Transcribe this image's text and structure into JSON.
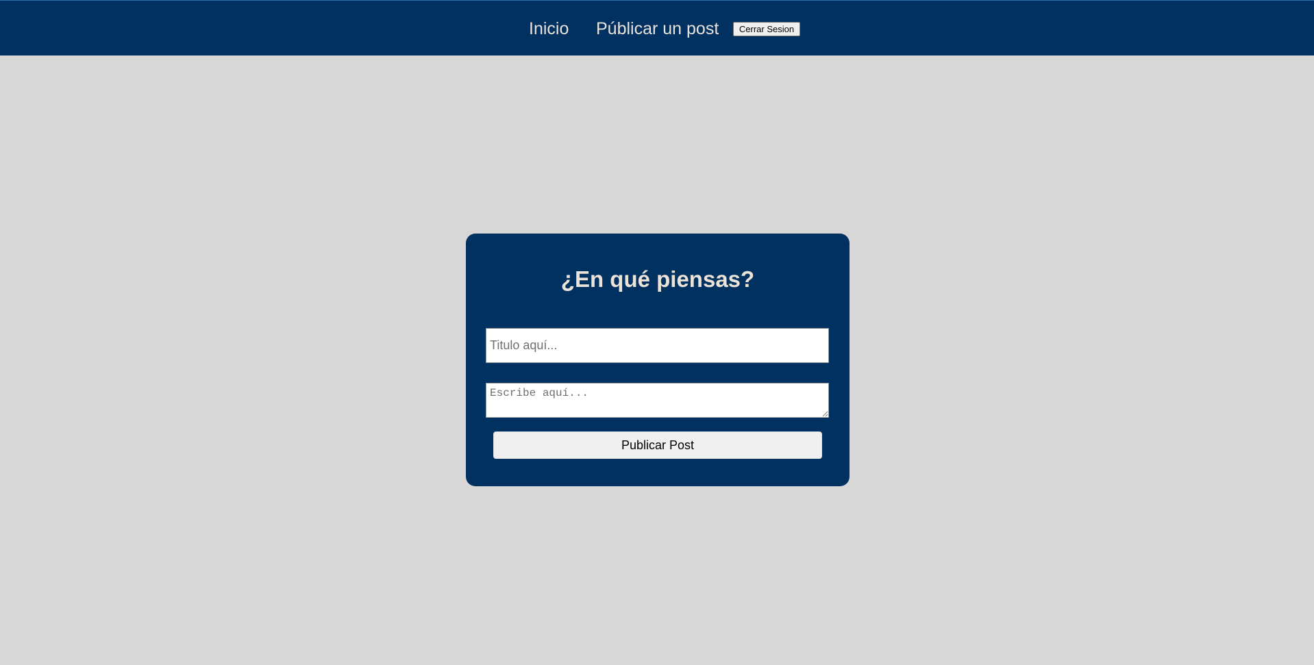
{
  "nav": {
    "home_label": "Inicio",
    "publish_label": "Públicar un post",
    "logout_label": "Cerrar Sesion"
  },
  "form": {
    "heading": "¿En qué piensas?",
    "title_placeholder": "Titulo aquí...",
    "title_value": "",
    "body_placeholder": "Escribe aquí...",
    "body_value": "",
    "submit_label": "Publicar Post"
  },
  "colors": {
    "navbar_bg": "#003160",
    "card_bg": "#003160",
    "page_bg": "#d7d7d7",
    "nav_text": "#e9e3dc",
    "heading_text": "#ebe2d8"
  }
}
